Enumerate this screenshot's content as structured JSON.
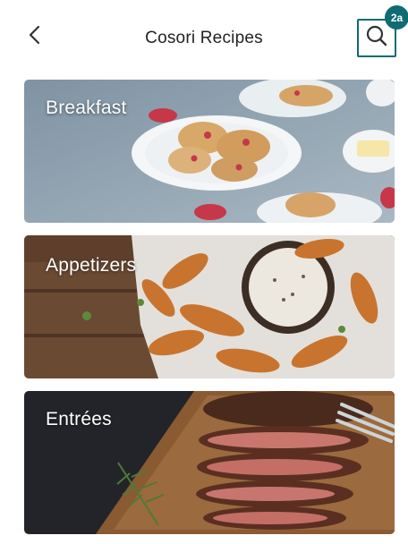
{
  "header": {
    "title": "Cosori Recipes",
    "back_icon": "chevron-left-icon",
    "search_icon": "search-icon",
    "step_badge": "2a",
    "accent_color": "#0f6b74"
  },
  "categories": [
    {
      "label": "Breakfast"
    },
    {
      "label": "Appetizers"
    },
    {
      "label": "Entrées"
    }
  ]
}
